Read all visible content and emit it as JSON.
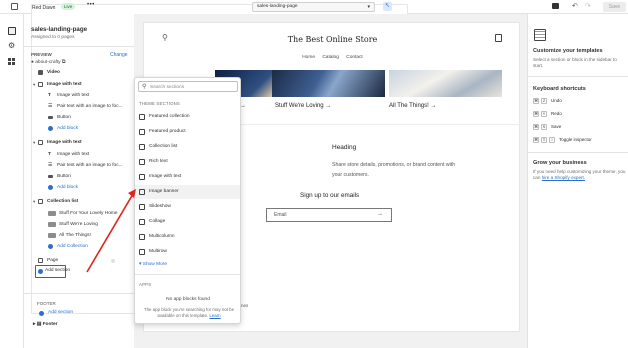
{
  "topbar": {
    "store_name": "Red Dawn",
    "live_badge": "Live",
    "more_label": "•••",
    "theme_selector": "sales-landing-page",
    "save_label": "Save"
  },
  "left_panel": {
    "title": "sales-landing-page",
    "subtitle": "Assigned to 0 pages",
    "preview_label": "PREVIEW",
    "change_label": "Change",
    "preview_page": "about-crafty",
    "rows": {
      "video": "Video",
      "image_with_text_1": "Image with text",
      "iwt1_image": "Image with text",
      "iwt1_pair": "Pair text with an image to foc...",
      "iwt1_button": "Button",
      "iwt1_add": "Add block",
      "image_with_text_2": "Image with text",
      "iwt2_image": "Image with text",
      "iwt2_pair": "Pair text with an image to foc...",
      "iwt2_button": "Button",
      "iwt2_add": "Add block",
      "collection_list": "Collection list",
      "cl_1": "Stuff For Your Lovely Home",
      "cl_2": "Stuff We're Loving",
      "cl_3": "All The Things!",
      "cl_add": "Add Collection",
      "page": "Page",
      "add_section": "Add section",
      "footer_caption": "FOOTER",
      "footer_add_section": "Add section",
      "footer": "Footer"
    }
  },
  "store_preview": {
    "store_name": "The Best Online Store",
    "nav": [
      "Home",
      "Catalog",
      "Contact"
    ],
    "collection_captions": [
      "Stuff We're Loving →",
      "All The Things! →"
    ],
    "partial_caption": "→",
    "heading": "Heading",
    "paragraph": "Share store details, promotions, or brand content with your customers.",
    "signup_heading": "Sign up to our emails",
    "email_placeholder": "Email",
    "email_arrow": "→",
    "ghost_text": "nes"
  },
  "section_picker": {
    "search_placeholder": "Search sections",
    "theme_sections_caption": "THEME SECTIONS",
    "items": [
      "Featured collection",
      "Featured product",
      "Collection list",
      "Rich text",
      "Image with text",
      "Image banner",
      "Slideshow",
      "Collage",
      "Multicolumn",
      "Multirow"
    ],
    "show_more": "Show More",
    "apps_caption": "APPS",
    "no_app_blocks": "No app blocks found",
    "hint": "The app block you're searching for may not be available on this template.",
    "hint_link": "Learn"
  },
  "right_panel": {
    "customize_title": "Customize your templates",
    "customize_text": "Select a section or block in the sidebar to start.",
    "shortcuts_title": "Keyboard shortcuts",
    "shortcuts": [
      {
        "keys": [
          "⌘",
          "Z"
        ],
        "label": "Undo"
      },
      {
        "keys": [
          "⌘",
          "Y"
        ],
        "label": "Redo"
      },
      {
        "keys": [
          "⌘",
          "S"
        ],
        "label": "Save"
      },
      {
        "keys": [
          "⌘",
          "⇧",
          "I"
        ],
        "label": "Toggle inspector"
      }
    ],
    "grow_title": "Grow your business",
    "grow_text": "If you need help customizing your theme, you can",
    "grow_link": "hire a Shopify expert."
  },
  "colors": {
    "accent_blue": "#2c6ecb",
    "highlight_red": "#d72c0d",
    "live_green": "#d7f2dc"
  }
}
